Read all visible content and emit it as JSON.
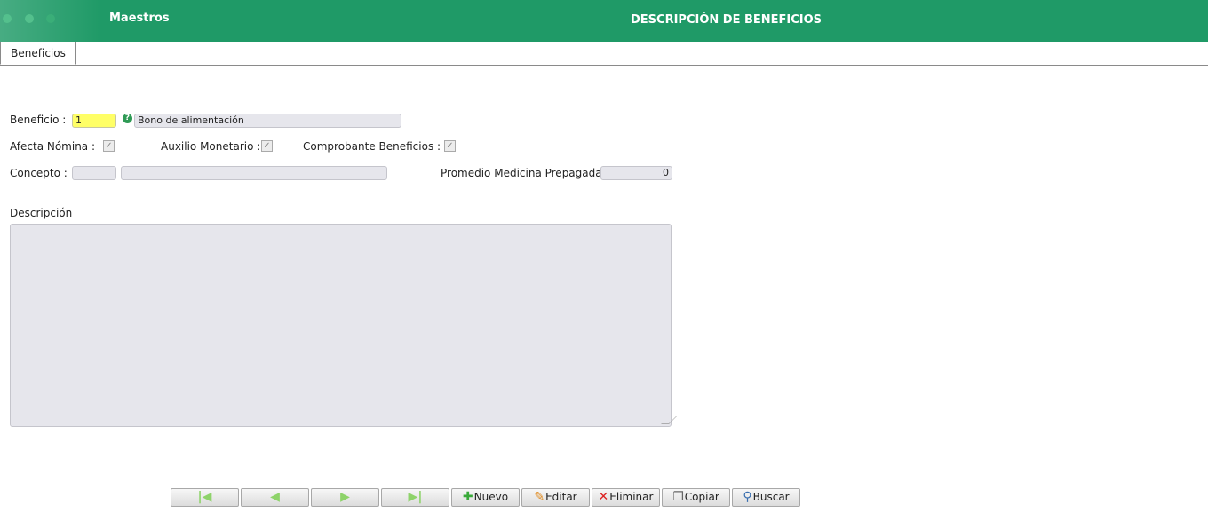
{
  "header": {
    "app_title": "Maestros",
    "page_title": "DESCRIPCIÓN DE BENEFICIOS",
    "color": "#1f9a67"
  },
  "tabs": [
    {
      "label": "Beneficios"
    }
  ],
  "form": {
    "beneficio_label": "Beneficio :",
    "beneficio_code": "1",
    "beneficio_name": "Bono de alimentación",
    "afecta_nomina_label": "Afecta Nómina :",
    "afecta_nomina_checked": true,
    "auxilio_label": "Auxilio Monetario :",
    "auxilio_checked": true,
    "comprobante_label": "Comprobante Beneficios :",
    "comprobante_checked": true,
    "concepto_label": "Concepto :",
    "concepto_code": "",
    "concepto_name": "",
    "promedio_label": "Promedio Medicina Prepagada :",
    "promedio_value": "0",
    "descripcion_label": "Descripción",
    "descripcion_value": ""
  },
  "toolbar": {
    "first_icon": "first-record-icon",
    "prev_icon": "prev-record-icon",
    "next_icon": "next-record-icon",
    "last_icon": "last-record-icon",
    "nuevo": "Nuevo",
    "editar": "Editar",
    "eliminar": "Eliminar",
    "copiar": "Copiar",
    "buscar": "Buscar"
  }
}
